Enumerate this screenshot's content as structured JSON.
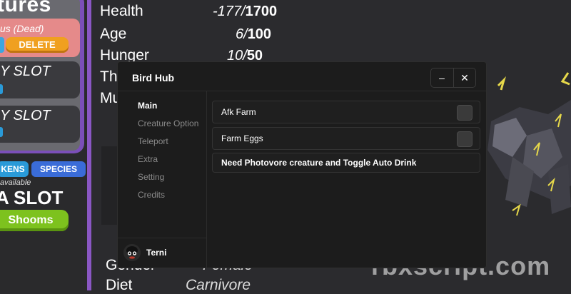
{
  "left_panel": {
    "title_fragment": "tures",
    "dead_status": "us (Dead)",
    "delete_label": "DELETE",
    "slots": [
      "Y SLOT",
      "Y SLOT"
    ],
    "tabs": [
      "KENS",
      "SPECIES"
    ],
    "available": "available",
    "a_slot": "A SLOT",
    "shooms_label": "Shooms"
  },
  "stats": [
    {
      "label": "Health",
      "current": "-177/",
      "max": "1700"
    },
    {
      "label": "Age",
      "current": "6/",
      "max": "100"
    },
    {
      "label": "Hunger",
      "current": "10/",
      "max": "50"
    },
    {
      "label": "Th",
      "current": "",
      "max": ""
    },
    {
      "label": "Mu",
      "current": "",
      "max": ""
    }
  ],
  "bottom_stats": {
    "gender_label": "Gender",
    "gender_value": "Female",
    "diet_label": "Diet",
    "diet_value": "Carnivore"
  },
  "hub": {
    "title": "Bird Hub",
    "minimize": "–",
    "close": "✕",
    "sidebar": [
      "Main",
      "Creature Option",
      "Teleport",
      "Extra",
      "Setting",
      "Credits"
    ],
    "active_tab": "Main",
    "user": "Terni",
    "rows": [
      {
        "label": "Afk Farm",
        "toggled": false
      },
      {
        "label": "Farm Eggs",
        "toggled": false
      }
    ],
    "note": "Need Photovore creature and Toggle Auto Drink"
  },
  "watermark": "rbxscript.com",
  "colors": {
    "accent_purple": "#8a57c4",
    "delete_orange": "#f0a020",
    "shooms_green": "#7dc21e",
    "tab_blue": "#2a9ad8"
  }
}
